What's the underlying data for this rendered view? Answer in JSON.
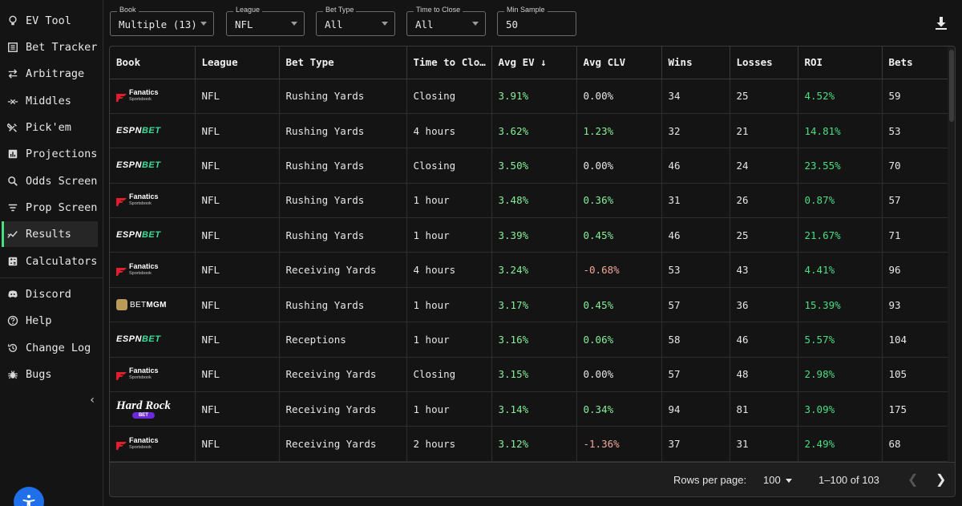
{
  "sidebar": {
    "items": [
      {
        "label": "EV Tool",
        "icon": "lightbulb-icon"
      },
      {
        "label": "Bet Tracker",
        "icon": "ledger-icon"
      },
      {
        "label": "Arbitrage",
        "icon": "arrows-swap-icon"
      },
      {
        "label": "Middles",
        "icon": "middle-icon"
      },
      {
        "label": "Pick'em",
        "icon": "tools-icon"
      },
      {
        "label": "Projections",
        "icon": "bar-chart-icon"
      },
      {
        "label": "Odds Screen",
        "icon": "search-icon"
      },
      {
        "label": "Prop Screen",
        "icon": "filter-lines-icon"
      },
      {
        "label": "Results",
        "icon": "line-chart-icon"
      },
      {
        "label": "Calculators",
        "icon": "calculator-icon"
      },
      {
        "label": "Discord",
        "icon": "discord-icon"
      },
      {
        "label": "Help",
        "icon": "help-icon"
      },
      {
        "label": "Change Log",
        "icon": "history-icon"
      },
      {
        "label": "Bugs",
        "icon": "bug-icon"
      }
    ],
    "active": "Results",
    "accent": "#4ade80"
  },
  "filters": {
    "book": {
      "label": "Book",
      "value": "Multiple (13)"
    },
    "league": {
      "label": "League",
      "value": "NFL"
    },
    "bet_type": {
      "label": "Bet Type",
      "value": "All"
    },
    "time_to_close": {
      "label": "Time to Close",
      "value": "All"
    },
    "min_sample": {
      "label": "Min Sample",
      "value": "50"
    }
  },
  "table": {
    "headers": [
      "Book",
      "League",
      "Bet Type",
      "Time to Clo…",
      "Avg EV ↓",
      "Avg CLV",
      "Wins",
      "Losses",
      "ROI",
      "Bets"
    ],
    "rows": [
      {
        "book": "Fanatics",
        "league": "NFL",
        "bet_type": "Rushing Yards",
        "time": "Closing",
        "ev": "3.91%",
        "clv": "0.00%",
        "wins": "34",
        "losses": "25",
        "roi": "4.52%",
        "bets": "59"
      },
      {
        "book": "ESPN BET",
        "league": "NFL",
        "bet_type": "Rushing Yards",
        "time": "4 hours",
        "ev": "3.62%",
        "clv": "1.23%",
        "wins": "32",
        "losses": "21",
        "roi": "14.81%",
        "bets": "53"
      },
      {
        "book": "ESPN BET",
        "league": "NFL",
        "bet_type": "Rushing Yards",
        "time": "Closing",
        "ev": "3.50%",
        "clv": "0.00%",
        "wins": "46",
        "losses": "24",
        "roi": "23.55%",
        "bets": "70"
      },
      {
        "book": "Fanatics",
        "league": "NFL",
        "bet_type": "Rushing Yards",
        "time": "1 hour",
        "ev": "3.48%",
        "clv": "0.36%",
        "wins": "31",
        "losses": "26",
        "roi": "0.87%",
        "bets": "57"
      },
      {
        "book": "ESPN BET",
        "league": "NFL",
        "bet_type": "Rushing Yards",
        "time": "1 hour",
        "ev": "3.39%",
        "clv": "0.45%",
        "wins": "46",
        "losses": "25",
        "roi": "21.67%",
        "bets": "71"
      },
      {
        "book": "Fanatics",
        "league": "NFL",
        "bet_type": "Receiving Yards",
        "time": "4 hours",
        "ev": "3.24%",
        "clv": "-0.68%",
        "wins": "53",
        "losses": "43",
        "roi": "4.41%",
        "bets": "96"
      },
      {
        "book": "BetMGM",
        "league": "NFL",
        "bet_type": "Rushing Yards",
        "time": "1 hour",
        "ev": "3.17%",
        "clv": "0.45%",
        "wins": "57",
        "losses": "36",
        "roi": "15.39%",
        "bets": "93"
      },
      {
        "book": "ESPN BET",
        "league": "NFL",
        "bet_type": "Receptions",
        "time": "1 hour",
        "ev": "3.16%",
        "clv": "0.06%",
        "wins": "58",
        "losses": "46",
        "roi": "5.57%",
        "bets": "104"
      },
      {
        "book": "Fanatics",
        "league": "NFL",
        "bet_type": "Receiving Yards",
        "time": "Closing",
        "ev": "3.15%",
        "clv": "0.00%",
        "wins": "57",
        "losses": "48",
        "roi": "2.98%",
        "bets": "105"
      },
      {
        "book": "Hard Rock Bet",
        "league": "NFL",
        "bet_type": "Receiving Yards",
        "time": "1 hour",
        "ev": "3.14%",
        "clv": "0.34%",
        "wins": "94",
        "losses": "81",
        "roi": "3.09%",
        "bets": "175"
      },
      {
        "book": "Fanatics",
        "league": "NFL",
        "bet_type": "Receiving Yards",
        "time": "2 hours",
        "ev": "3.12%",
        "clv": "-1.36%",
        "wins": "37",
        "losses": "31",
        "roi": "2.49%",
        "bets": "68"
      }
    ]
  },
  "logos": {
    "fanatics_line1": "Fanatics",
    "fanatics_line2": "Sportsbook",
    "espn_a": "ESPN",
    "espn_b": "BET",
    "mgm_a": "BET",
    "mgm_b": "MGM",
    "hardrock_a": "Hard Rock",
    "hardrock_b": "BET"
  },
  "pagination": {
    "rows_per_page_label": "Rows per page:",
    "rows_per_page": "100",
    "range": "1–100 of 103"
  }
}
